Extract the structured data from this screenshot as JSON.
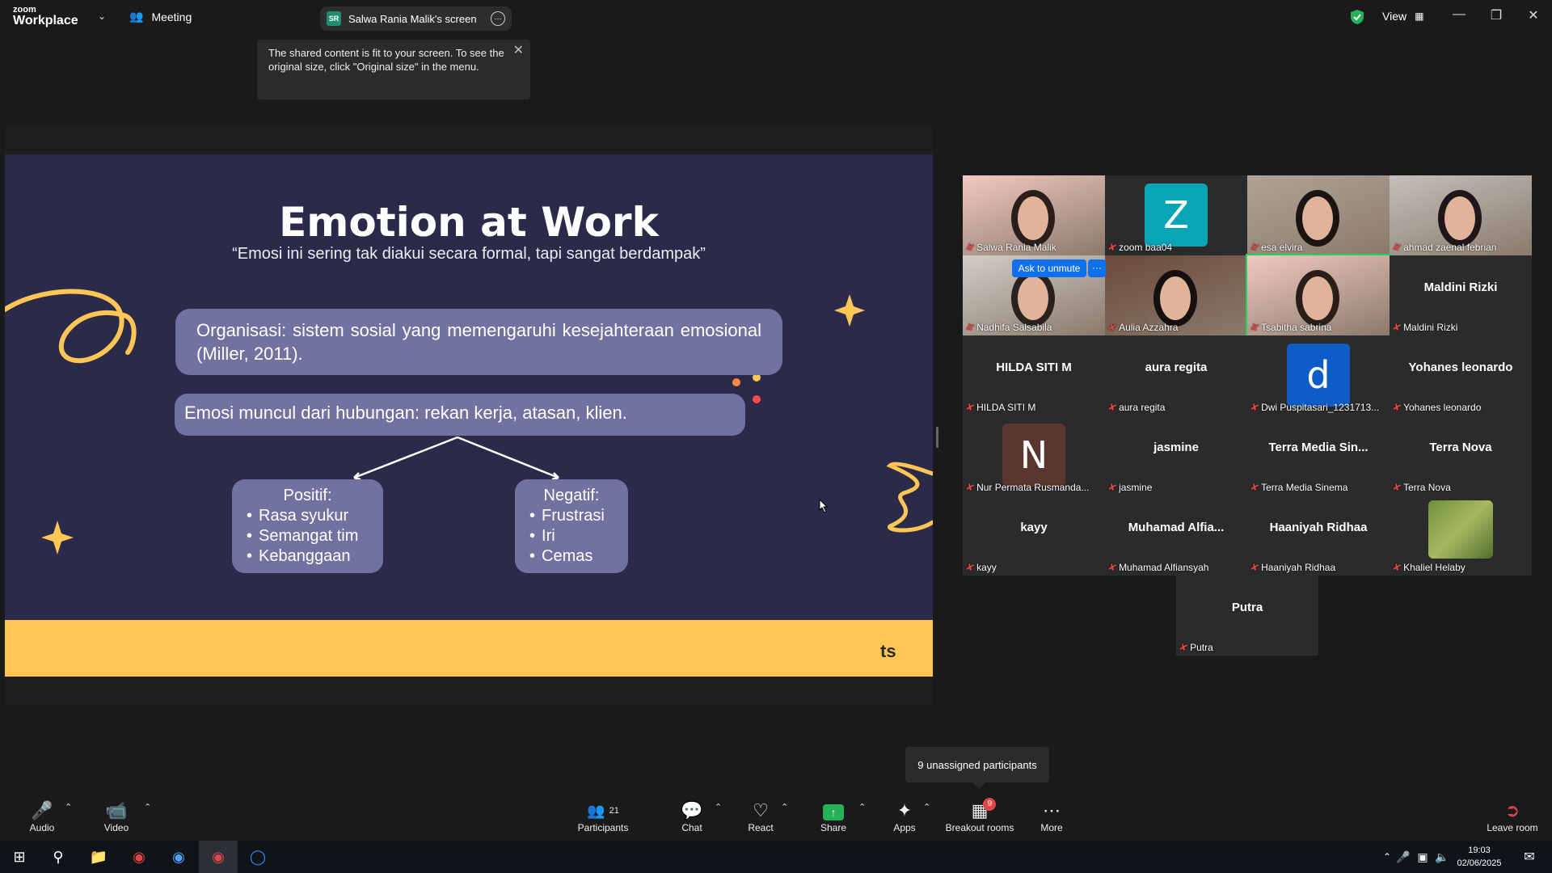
{
  "topbar": {
    "logo_small": "zoom",
    "logo_big": "Workplace",
    "meeting_label": "Meeting",
    "share_initials": "SR",
    "share_label": "Salwa Rania Malik's screen",
    "view_label": "View",
    "icons": [
      "chevron-down-icon",
      "people-icon",
      "more-icon",
      "shield-check-icon",
      "grid-icon",
      "minimize-icon",
      "maximize-icon",
      "close-icon"
    ]
  },
  "tooltip": {
    "text": "The shared content is fit to your screen. To see the original size, click \"Original size\" in the menu."
  },
  "slide": {
    "title": "Emotion at Work",
    "subtitle": "“Emosi ini sering tak diakui secara formal, tapi sangat berdampak”",
    "box1": "Organisasi: sistem sosial yang memengaruhi kesejahteraan emosional (Miller, 2011).",
    "box2": "Emosi muncul dari hubungan: rekan kerja, atasan, klien.",
    "positive": {
      "heading": "Positif:",
      "items": [
        "Rasa syukur",
        "Semangat tim",
        "Kebanggaan"
      ]
    },
    "negative": {
      "heading": "Negatif:",
      "items": [
        "Frustrasi",
        "Iri",
        "Cemas"
      ]
    },
    "footer_mark": "ts",
    "colors": {
      "bg": "#2c2a4a",
      "box": "#7272a1",
      "accent": "#ffc655"
    }
  },
  "gallery": {
    "ask_to_unmute": "Ask to unmute",
    "ask_more": "···",
    "tiles": [
      {
        "name": "Salwa Rania Malik",
        "type": "video"
      },
      {
        "name": "zoom baa04",
        "type": "avatar",
        "letter": "Z",
        "color": "#0aa5b5"
      },
      {
        "name": "esa elvira",
        "type": "video"
      },
      {
        "name": "ahmad zaenal febrian",
        "type": "video"
      },
      {
        "name": "Nadhifa Salsabila",
        "type": "video"
      },
      {
        "name": "Aulia Azzahra",
        "type": "video"
      },
      {
        "name": "Tsabitha sabrina",
        "type": "video",
        "active": true
      },
      {
        "name": "Maldini Rizki",
        "type": "text",
        "display": "Maldini Rizki"
      },
      {
        "name": "HILDA SITI M",
        "type": "text",
        "display": "HILDA SITI M"
      },
      {
        "name": "aura regita",
        "type": "text",
        "display": "aura regita"
      },
      {
        "name": "Dwi Puspitasari_1231713...",
        "type": "avatar",
        "letter": "d",
        "color": "#0e5cc7"
      },
      {
        "name": "Yohanes leonardo",
        "type": "text",
        "display": "Yohanes leonardo"
      },
      {
        "name": "Nur Permata Rusmanda...",
        "type": "avatar",
        "letter": "N",
        "color": "#5a3630"
      },
      {
        "name": "jasmine",
        "type": "text",
        "display": "jasmine"
      },
      {
        "name": "Terra Media Sinema",
        "type": "text",
        "display": "Terra Media Sin..."
      },
      {
        "name": "Terra Nova",
        "type": "text",
        "display": "Terra Nova"
      },
      {
        "name": "kayy",
        "type": "text",
        "display": "kayy"
      },
      {
        "name": "Muhamad Alfiansyah",
        "type": "text",
        "display": "Muhamad Alfia..."
      },
      {
        "name": "Haaniyah Ridhaa",
        "type": "text",
        "display": "Haaniyah Ridhaa"
      },
      {
        "name": "Khaliel Helaby",
        "type": "image"
      },
      {
        "name": "Putra",
        "type": "text",
        "display": "Putra"
      }
    ]
  },
  "unassigned": "9 unassigned participants",
  "toolbar": {
    "audio": "Audio",
    "video": "Video",
    "participants": "Participants",
    "participants_count": "21",
    "chat": "Chat",
    "react": "React",
    "share": "Share",
    "apps": "Apps",
    "breakout": "Breakout rooms",
    "breakout_badge": "9",
    "more": "More",
    "leave": "Leave room"
  },
  "taskbar": {
    "time": "19:03",
    "date": "02/06/2025"
  }
}
